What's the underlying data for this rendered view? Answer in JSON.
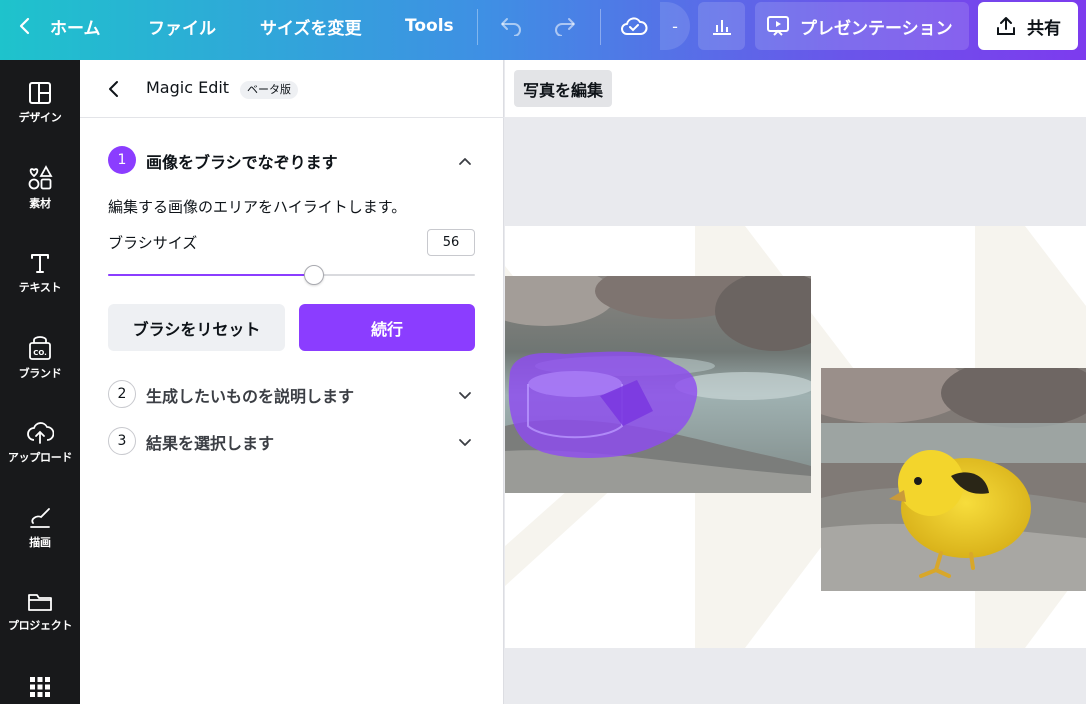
{
  "topbar": {
    "home_label": "ホーム",
    "file_label": "ファイル",
    "resize_label": "サイズを変更",
    "tools_label": "Tools",
    "dash_label": "-",
    "present_label": "プレゼンテーション",
    "share_label": "共有"
  },
  "rail": {
    "items": [
      {
        "label": "デザイン",
        "icon": "layout-icon"
      },
      {
        "label": "素材",
        "icon": "elements-icon"
      },
      {
        "label": "テキスト",
        "icon": "text-icon"
      },
      {
        "label": "ブランド",
        "icon": "brand-icon"
      },
      {
        "label": "アップロード",
        "icon": "upload-icon"
      },
      {
        "label": "描画",
        "icon": "draw-icon"
      },
      {
        "label": "プロジェクト",
        "icon": "folder-icon"
      }
    ]
  },
  "panel": {
    "title": "Magic Edit",
    "badge": "ベータ版",
    "steps": [
      {
        "number": "1",
        "title": "画像をブラシでなぞります"
      },
      {
        "number": "2",
        "title": "生成したいものを説明します"
      },
      {
        "number": "3",
        "title": "結果を選択します"
      }
    ],
    "description": "編集する画像のエリアをハイライトします。",
    "brush_size_label": "ブラシサイズ",
    "brush_size_value": "56",
    "brush_slider_fraction": 0.56,
    "reset_label": "ブラシをリセット",
    "continue_label": "続行"
  },
  "canvas": {
    "edit_photo_label": "写真を編集"
  },
  "colors": {
    "accent": "#8b3dff",
    "rail_bg": "#18191b",
    "topbar_gradient": [
      "#1ec3cc",
      "#7d3bee"
    ]
  }
}
